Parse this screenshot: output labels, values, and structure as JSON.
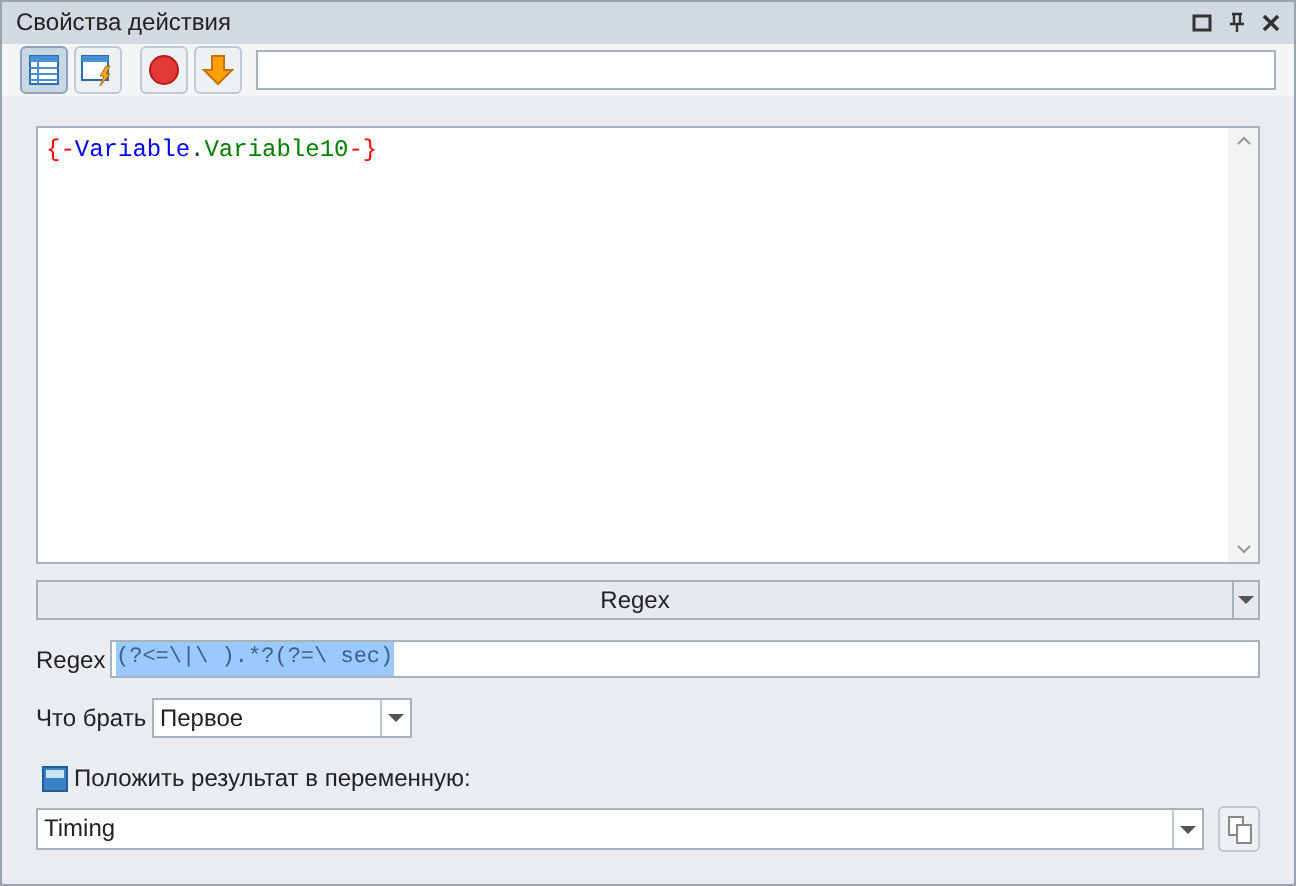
{
  "window": {
    "title": "Свойства действия"
  },
  "toolbar": {
    "buttons": [
      {
        "kind": "table",
        "selected": true
      },
      {
        "kind": "window-lightning",
        "selected": false
      },
      {
        "kind": "stop",
        "selected": false
      },
      {
        "kind": "down",
        "selected": false
      }
    ]
  },
  "editor": {
    "tokens": [
      {
        "text": "{-",
        "color": "#ff0000"
      },
      {
        "text": "Variable",
        "color": "#0000ff"
      },
      {
        "text": ".",
        "color": "#333333"
      },
      {
        "text": "Variable10",
        "color": "#008000"
      },
      {
        "text": "-}",
        "color": "#ff0000"
      }
    ]
  },
  "mode_select": {
    "value": "Regex"
  },
  "regex": {
    "label": "Regex",
    "value": "(?<=\\|\\ ).*?(?=\\ sec)",
    "selected": true
  },
  "take": {
    "label": "Что брать",
    "value": "Первое"
  },
  "save_result": {
    "label": "Положить результат в переменную:"
  },
  "variable": {
    "value": "Timing"
  }
}
